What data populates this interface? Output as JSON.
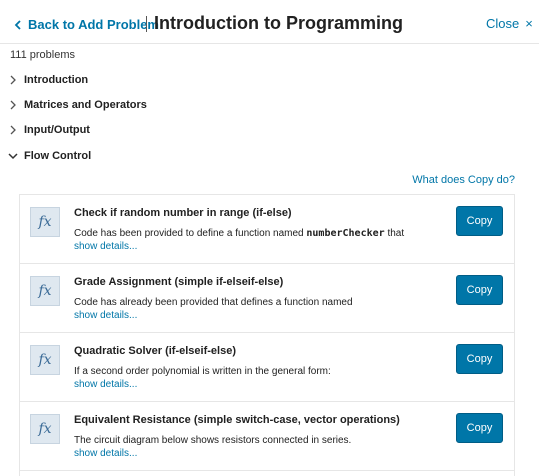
{
  "header": {
    "back_label": "Back to Add Problem",
    "separator": "|",
    "title": "Introduction to Programming",
    "close_label": "Close",
    "close_glyph": "×"
  },
  "problem_count": "111 problems",
  "sections": [
    {
      "label": "Introduction",
      "expanded": false
    },
    {
      "label": "Matrices and Operators",
      "expanded": false
    },
    {
      "label": "Input/Output",
      "expanded": false
    },
    {
      "label": "Flow Control",
      "expanded": true
    }
  ],
  "copy_help": "What does Copy do?",
  "problems": [
    {
      "icon": "fx",
      "title": "Check if random number in range (if-else)",
      "desc_before": "Code has been provided to define a function named ",
      "desc_code": "numberChecker",
      "desc_after": " that",
      "show_details": "show details...",
      "copy_label": "Copy"
    },
    {
      "icon": "fx",
      "title": "Grade Assignment (simple if-elseif-else)",
      "desc_before": "Code has already been provided that defines a function named",
      "desc_code": "",
      "desc_after": "",
      "show_details": "show details...",
      "copy_label": "Copy"
    },
    {
      "icon": "fx",
      "title": "Quadratic Solver (if-elseif-else)",
      "desc_before": "If a second order polynomial is written in the general form:",
      "desc_code": "",
      "desc_after": "",
      "show_details": "show details...",
      "copy_label": "Copy"
    },
    {
      "icon": "fx",
      "title": "Equivalent Resistance (simple switch-case, vector operations)",
      "desc_before": "The circuit diagram below shows resistors connected in series.",
      "desc_code": "",
      "desc_after": "",
      "show_details": "show details...",
      "copy_label": "Copy"
    }
  ],
  "colors": {
    "link": "#0076a8",
    "button": "#0076a8",
    "icon_bg": "#dfe8f0"
  }
}
